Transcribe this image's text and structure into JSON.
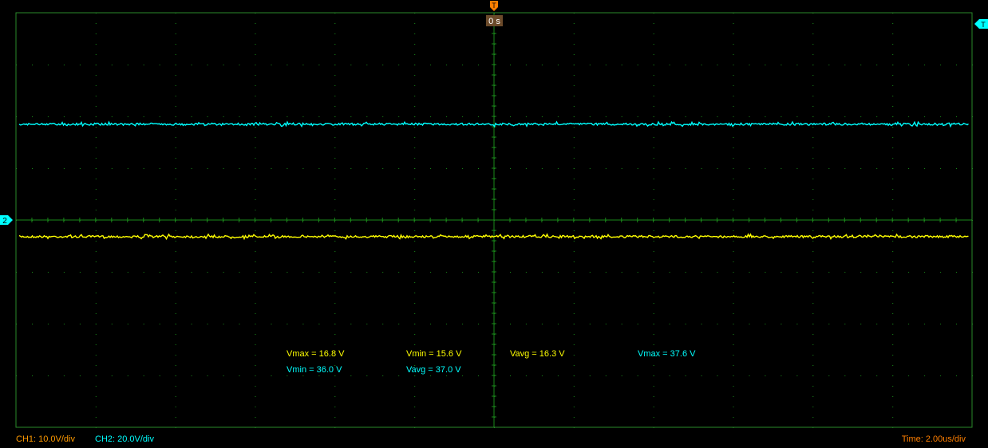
{
  "chart_data": {
    "type": "line",
    "x_divisions": 12,
    "y_divisions": 8,
    "minor_ticks_per_division": 5,
    "grid": true,
    "series": [
      {
        "channel": "CH1",
        "color": "#ffff00",
        "volts_per_div": 10.0,
        "value_divisions_above_ground": -0.32,
        "noise_divisions": 0.04
      },
      {
        "channel": "CH2",
        "color": "#00ffff",
        "volts_per_div": 20.0,
        "value_divisions_above_ground": 1.85,
        "noise_divisions": 0.04
      }
    ],
    "markers": {
      "trigger_top": {
        "label": "T",
        "color": "#ff7f00"
      },
      "trigger_time": {
        "label": "0 s"
      },
      "trigger_level": {
        "label": "T",
        "color": "#00ffff"
      },
      "ch2_ground": {
        "label": "2",
        "color": "#00ffff"
      }
    },
    "measurements": [
      {
        "text": "Vmax = 16.8 V",
        "color": "#ffff00"
      },
      {
        "text": "Vmin = 15.6 V",
        "color": "#ffff00"
      },
      {
        "text": "Vavg = 16.3 V",
        "color": "#ffff00"
      },
      {
        "text": "Vmax = 37.6 V",
        "color": "#00ffff"
      },
      {
        "text": "Vmin = 36.0 V",
        "color": "#00ffff"
      },
      {
        "text": "Vavg = 37.0 V",
        "color": "#00ffff"
      }
    ]
  },
  "status_bar": {
    "ch1": {
      "text": "CH1: 10.0V/div",
      "color": "#ff9a00"
    },
    "ch2": {
      "text": "CH2: 20.0V/div",
      "color": "#00ffff"
    },
    "time": {
      "text": "Time: 2.00us/div",
      "color": "#ff7f00"
    }
  },
  "colors": {
    "background": "#000000",
    "grid": "#1a8a1a",
    "border": "#2a8a2a"
  }
}
